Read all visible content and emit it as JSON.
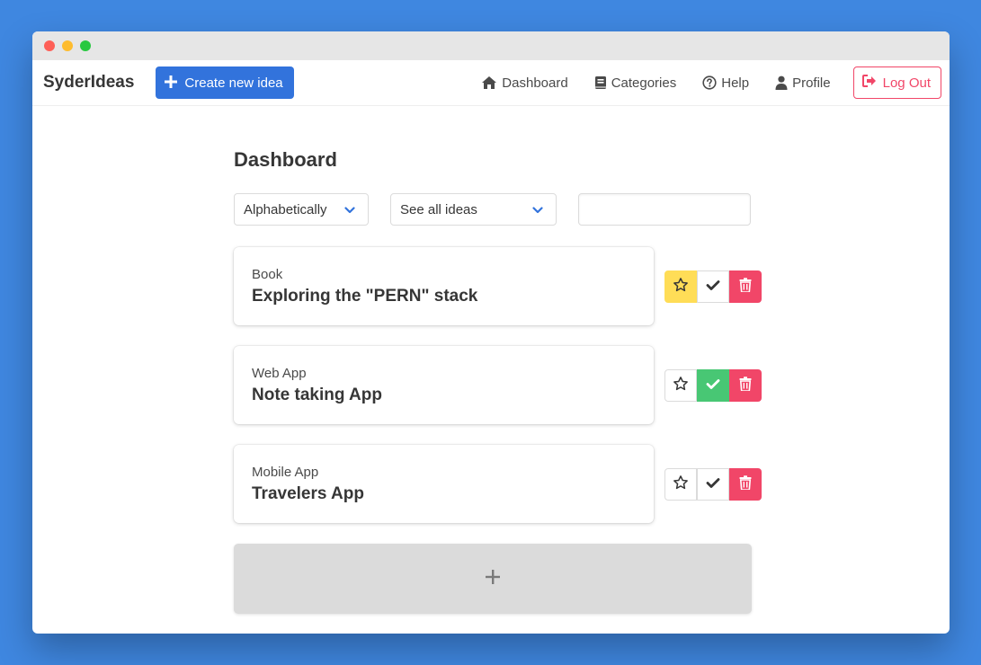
{
  "app": {
    "brand": "SyderIdeas"
  },
  "header": {
    "create_label": "Create new idea",
    "nav": [
      {
        "label": "Dashboard",
        "icon": "home-icon"
      },
      {
        "label": "Categories",
        "icon": "book-icon"
      },
      {
        "label": "Help",
        "icon": "question-circle-icon"
      },
      {
        "label": "Profile",
        "icon": "user-icon"
      }
    ],
    "logout_label": "Log Out"
  },
  "page": {
    "title": "Dashboard"
  },
  "filters": {
    "sort_value": "Alphabetically",
    "view_value": "See all ideas",
    "search_value": ""
  },
  "ideas": [
    {
      "category": "Book",
      "title": "Exploring the \"PERN\" stack",
      "favorite": true,
      "done": false
    },
    {
      "category": "Web App",
      "title": "Note taking App",
      "favorite": false,
      "done": true
    },
    {
      "category": "Mobile App",
      "title": "Travelers App",
      "favorite": false,
      "done": false
    }
  ],
  "add_card": {
    "icon": "plus-icon"
  },
  "colors": {
    "primary": "#3273dc",
    "danger": "#f14668",
    "warning": "#ffdd57",
    "success": "#48c774",
    "background": "#3f87e0"
  }
}
